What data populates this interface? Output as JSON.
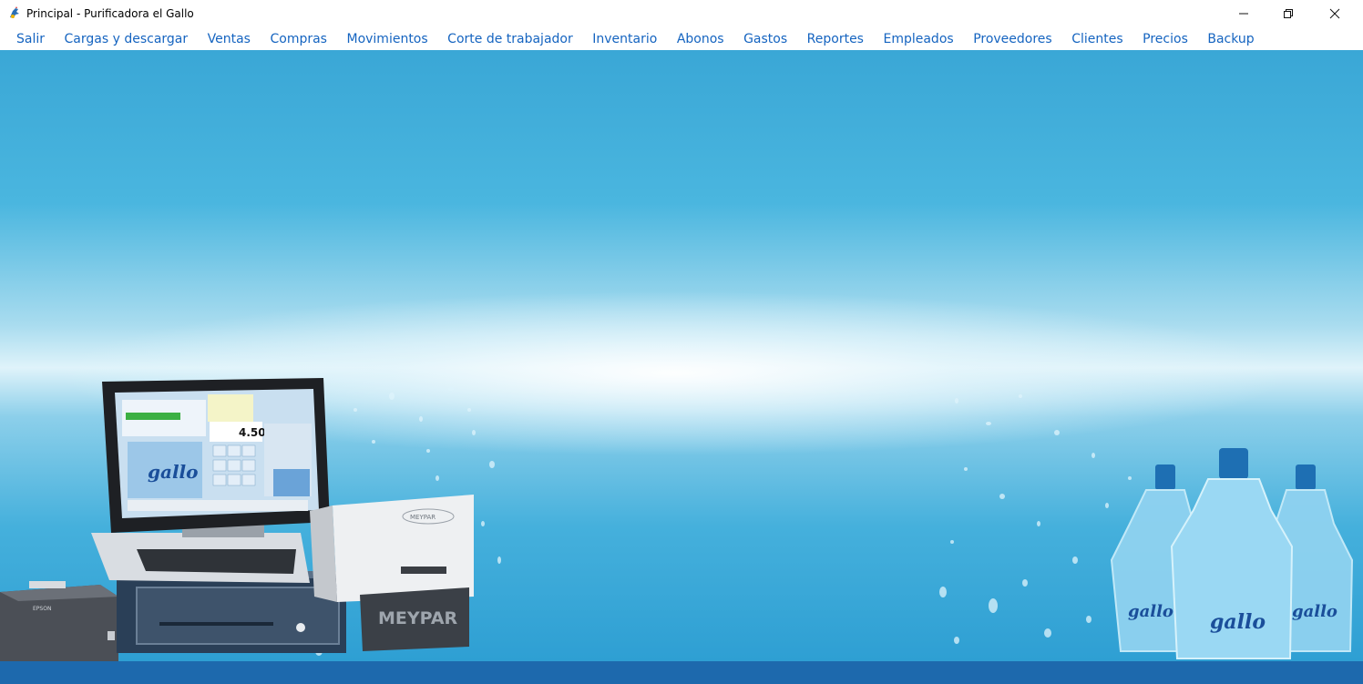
{
  "window": {
    "title": "Principal - Purificadora el Gallo",
    "controls": {
      "minimize": "–",
      "maximize": "❐",
      "close": "✕"
    }
  },
  "menu": {
    "items": [
      "Salir",
      "Cargas y descargar",
      "Ventas",
      "Compras",
      "Movimientos",
      "Corte de trabajador",
      "Inventario",
      "Abonos",
      "Gastos",
      "Reportes",
      "Empleados",
      "Proveedores",
      "Clientes",
      "Precios",
      "Backup"
    ]
  },
  "pos_screen": {
    "amount": "4.50",
    "logo_text": "gallo"
  },
  "hardware": {
    "printer_brand": "EPSON",
    "pos_brand": "MEYPAR",
    "pos_brand_small": "MEYPAR"
  },
  "bottles": {
    "logo_text": "gallo"
  },
  "colors": {
    "menu_text": "#1564c0",
    "footer_bg": "#1d69ad",
    "background_top": "#3aa7d6",
    "background_bottom": "#2e9fd3"
  },
  "icons": {
    "app": "rooster-app-icon",
    "minimize": "minimize-icon",
    "maximize": "restore-icon",
    "close": "close-icon"
  }
}
